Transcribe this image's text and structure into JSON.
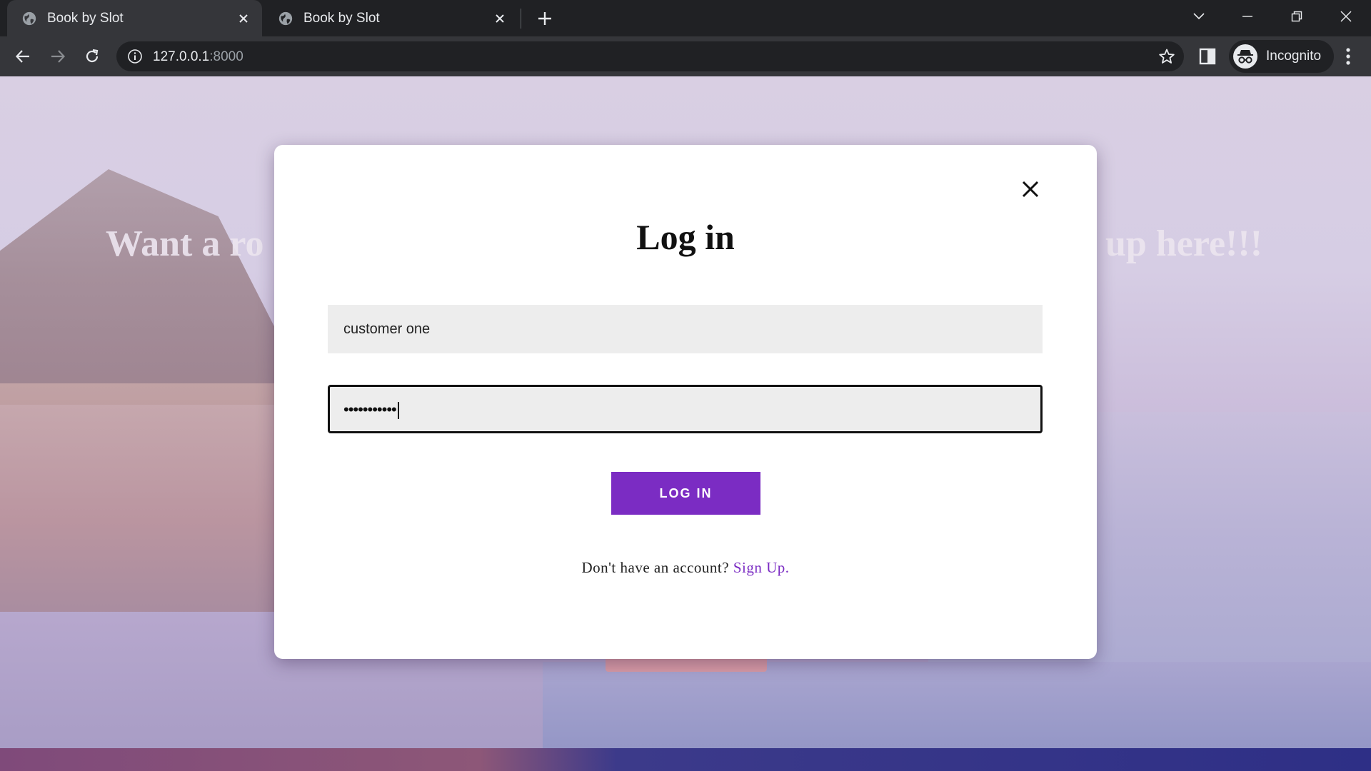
{
  "browser": {
    "tabs": [
      {
        "title": "Book by Slot",
        "active": true
      },
      {
        "title": "Book by Slot",
        "active": false
      }
    ],
    "url_host": "127.0.0.1",
    "url_port": ":8000",
    "profile_label": "Incognito"
  },
  "page": {
    "hero_left": "Want a ro",
    "hero_right": "up here!!!"
  },
  "modal": {
    "title": "Log in",
    "username_value": "customer one",
    "password_mask": "•••••••••••",
    "login_button": "LOG IN",
    "signup_prompt": "Don't have an account?",
    "signup_link": "Sign Up."
  },
  "colors": {
    "accent": "#7b2cc3",
    "chrome_dark": "#202124",
    "chrome_toolbar": "#35363a"
  },
  "icons": [
    "globe-icon",
    "close-icon",
    "plus-icon",
    "chevron-down-icon",
    "minimize-icon",
    "restore-icon",
    "back-arrow-icon",
    "forward-arrow-icon",
    "reload-icon",
    "info-icon",
    "star-icon",
    "side-panel-icon",
    "incognito-icon",
    "kebab-menu-icon"
  ]
}
